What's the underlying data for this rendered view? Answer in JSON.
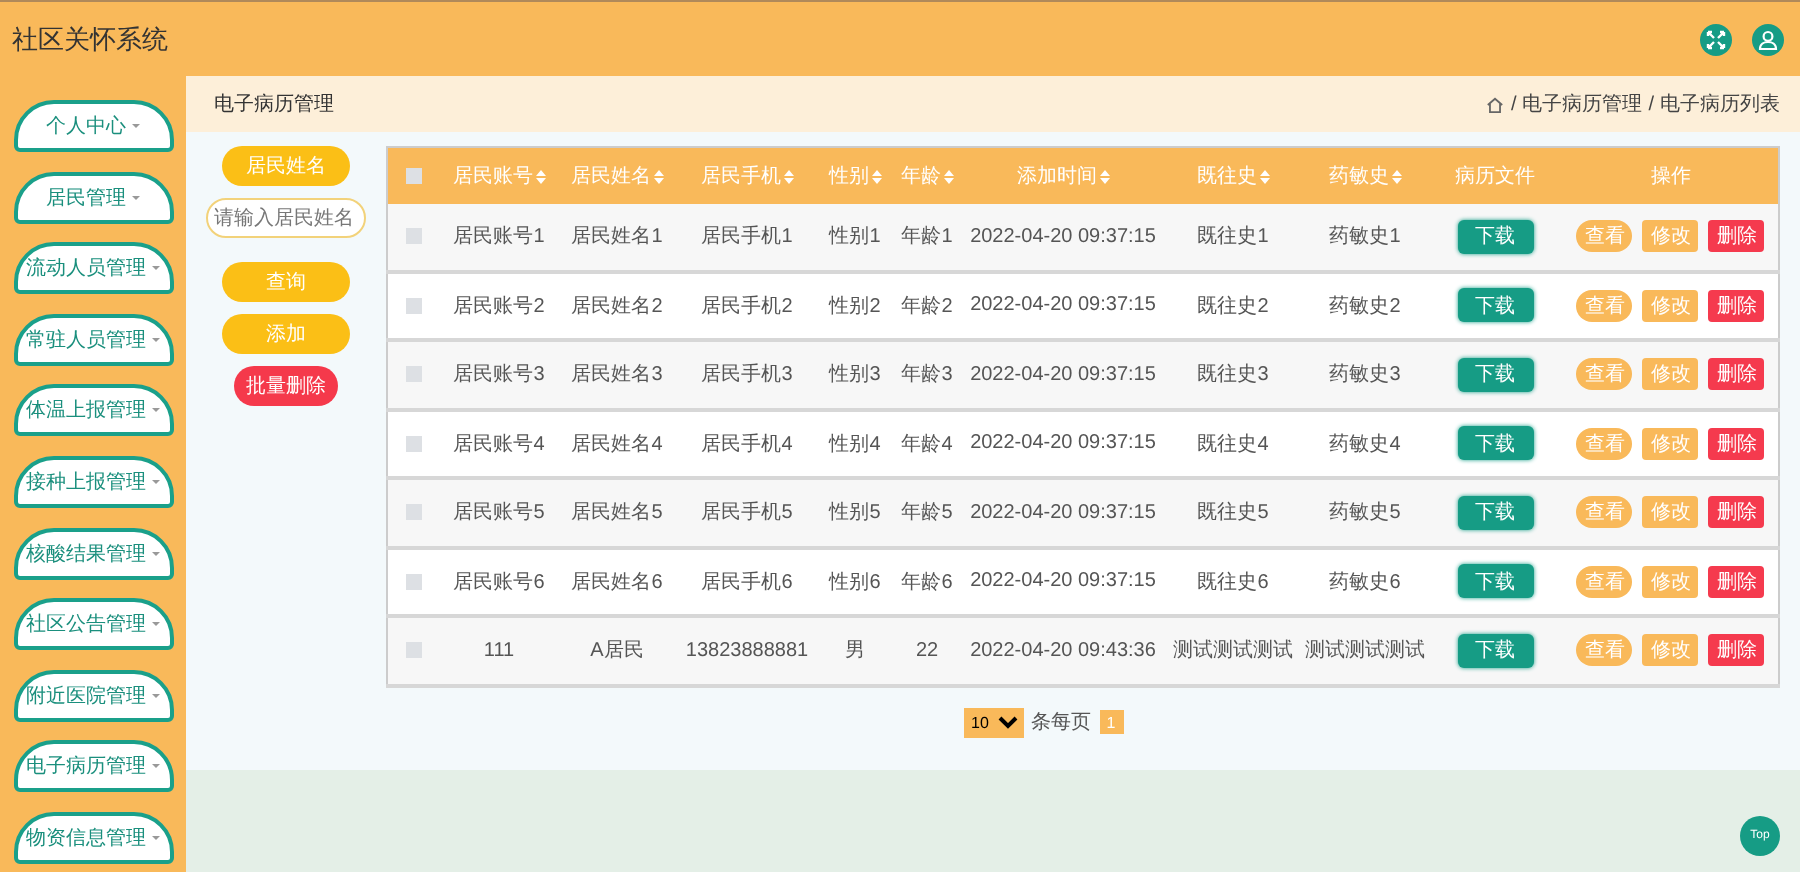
{
  "app_title": "社区关怀系统",
  "sidebar": {
    "items": [
      {
        "label": "个人中心",
        "selected": false
      },
      {
        "label": "居民管理",
        "selected": false
      },
      {
        "label": "流动人员管理",
        "selected": false
      },
      {
        "label": "常驻人员管理",
        "selected": false
      },
      {
        "label": "体温上报管理",
        "selected": false
      },
      {
        "label": "接种上报管理",
        "selected": false
      },
      {
        "label": "核酸结果管理",
        "selected": false
      },
      {
        "label": "社区公告管理",
        "selected": false
      },
      {
        "label": "附近医院管理",
        "selected": false
      },
      {
        "label": "电子病历管理",
        "selected": false
      },
      {
        "label": "物资信息管理",
        "selected": false
      }
    ]
  },
  "page_title": "电子病历管理",
  "breadcrumb": [
    {
      "separator": "/",
      "label": "电子病历管理"
    },
    {
      "separator": "/",
      "label": "电子病历列表"
    }
  ],
  "search": {
    "label": "居民姓名",
    "placeholder": "请输入居民姓名",
    "buttons": [
      {
        "kind": "primary",
        "label": "查询"
      },
      {
        "kind": "primary",
        "label": "添加"
      },
      {
        "kind": "danger",
        "label": "批量删除"
      }
    ]
  },
  "table": {
    "select_all": {
      "checked": false
    },
    "columns": [
      {
        "label": "居民账号",
        "sortable": true
      },
      {
        "label": "居民姓名",
        "sortable": true
      },
      {
        "label": "居民手机",
        "sortable": true
      },
      {
        "label": "性别",
        "sortable": true
      },
      {
        "label": "年龄",
        "sortable": true
      },
      {
        "label": "添加时间",
        "sortable": true
      },
      {
        "label": "既往史",
        "sortable": true
      },
      {
        "label": "药敏史",
        "sortable": true
      },
      {
        "label": "病历文件",
        "sortable": false
      },
      {
        "label": "操作",
        "sortable": false
      }
    ],
    "rows": [
      {
        "checked": false,
        "cells": [
          "居民账号1",
          "居民姓名1",
          "居民手机1",
          "性别1",
          "年龄1",
          "2022-04-20 09:37:15",
          "既往史1",
          "药敏史1"
        ],
        "file_button": "下载",
        "actions": [
          {
            "kind": "view",
            "label": "查看"
          },
          {
            "kind": "edit",
            "label": "修改"
          },
          {
            "kind": "delete",
            "label": "删除"
          }
        ]
      },
      {
        "checked": false,
        "cells": [
          "居民账号2",
          "居民姓名2",
          "居民手机2",
          "性别2",
          "年龄2",
          "2022-04-20 09:37:15",
          "既往史2",
          "药敏史2"
        ],
        "file_button": "下载",
        "actions": [
          {
            "kind": "view",
            "label": "查看"
          },
          {
            "kind": "edit",
            "label": "修改"
          },
          {
            "kind": "delete",
            "label": "删除"
          }
        ]
      },
      {
        "checked": false,
        "cells": [
          "居民账号3",
          "居民姓名3",
          "居民手机3",
          "性别3",
          "年龄3",
          "2022-04-20 09:37:15",
          "既往史3",
          "药敏史3"
        ],
        "file_button": "下载",
        "actions": [
          {
            "kind": "view",
            "label": "查看"
          },
          {
            "kind": "edit",
            "label": "修改"
          },
          {
            "kind": "delete",
            "label": "删除"
          }
        ]
      },
      {
        "checked": false,
        "cells": [
          "居民账号4",
          "居民姓名4",
          "居民手机4",
          "性别4",
          "年龄4",
          "2022-04-20 09:37:15",
          "既往史4",
          "药敏史4"
        ],
        "file_button": "下载",
        "actions": [
          {
            "kind": "view",
            "label": "查看"
          },
          {
            "kind": "edit",
            "label": "修改"
          },
          {
            "kind": "delete",
            "label": "删除"
          }
        ]
      },
      {
        "checked": false,
        "cells": [
          "居民账号5",
          "居民姓名5",
          "居民手机5",
          "性别5",
          "年龄5",
          "2022-04-20 09:37:15",
          "既往史5",
          "药敏史5"
        ],
        "file_button": "下载",
        "actions": [
          {
            "kind": "view",
            "label": "查看"
          },
          {
            "kind": "edit",
            "label": "修改"
          },
          {
            "kind": "delete",
            "label": "删除"
          }
        ]
      },
      {
        "checked": false,
        "cells": [
          "居民账号6",
          "居民姓名6",
          "居民手机6",
          "性别6",
          "年龄6",
          "2022-04-20 09:37:15",
          "既往史6",
          "药敏史6"
        ],
        "file_button": "下载",
        "actions": [
          {
            "kind": "view",
            "label": "查看"
          },
          {
            "kind": "edit",
            "label": "修改"
          },
          {
            "kind": "delete",
            "label": "删除"
          }
        ]
      },
      {
        "checked": false,
        "cells": [
          "111",
          "A居民",
          "13823888881",
          "男",
          "22",
          "2022-04-20 09:43:36",
          "测试测试测试",
          "测试测试测试"
        ],
        "file_button": "下载",
        "actions": [
          {
            "kind": "view",
            "label": "查看"
          },
          {
            "kind": "edit",
            "label": "修改"
          },
          {
            "kind": "delete",
            "label": "删除"
          }
        ]
      }
    ]
  },
  "pagination": {
    "page_size": "10",
    "page_size_label": "条每页",
    "pages": [
      {
        "label": "1",
        "selected": true
      }
    ]
  },
  "top_button": "Top"
}
